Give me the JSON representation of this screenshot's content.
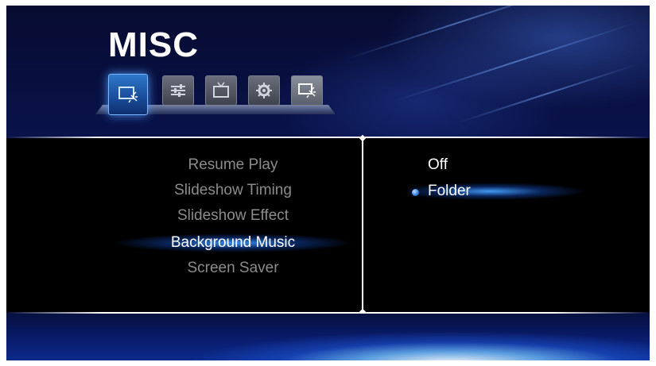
{
  "header": {
    "title": "MISC",
    "tabs": [
      {
        "icon": "screen-saver-icon",
        "active": true
      },
      {
        "icon": "sliders-icon",
        "active": false
      },
      {
        "icon": "tv-icon",
        "active": false
      },
      {
        "icon": "gear-icon",
        "active": false
      },
      {
        "icon": "screen-saver-icon",
        "active": false
      }
    ]
  },
  "menu": {
    "items": [
      {
        "label": "Resume Play"
      },
      {
        "label": "Slideshow Timing"
      },
      {
        "label": "Slideshow Effect"
      },
      {
        "label": "Background Music"
      },
      {
        "label": "Screen Saver"
      }
    ],
    "selected": "Background Music"
  },
  "options": {
    "items": [
      {
        "label": "Off"
      },
      {
        "label": "Folder"
      }
    ],
    "selected": "Folder"
  },
  "colors": {
    "accent": "#2c7fe0",
    "background": "#0a1450",
    "panel": "#000000"
  }
}
